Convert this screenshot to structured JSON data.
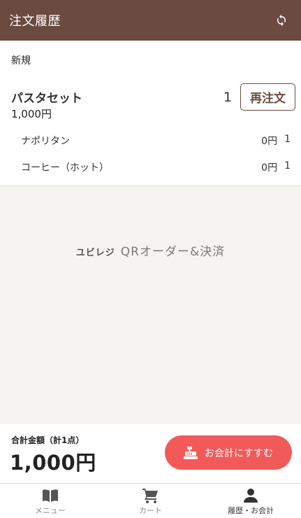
{
  "header": {
    "title": "注文履歴",
    "refresh_icon": "refresh-icon"
  },
  "order": {
    "section_label": "新規",
    "item": {
      "name": "パスタセット",
      "price": "1,000円",
      "quantity": "1",
      "reorder_label": "再注文"
    },
    "sub_items": [
      {
        "name": "ナポリタン",
        "price": "0円",
        "quantity": "1"
      },
      {
        "name": "コーヒー（ホット）",
        "price": "0円",
        "quantity": "1"
      }
    ]
  },
  "brand": {
    "prefix": "ユビレジ",
    "text": "QRオーダー&決済"
  },
  "footer": {
    "total_label": "合計金額（計1点）",
    "total_amount": "1,000円",
    "checkout_label": "お会計にすすむ",
    "checkout_icon": "cash-register-icon",
    "checkout_color": "#f25a5a"
  },
  "tabs": [
    {
      "label": "メニュー",
      "icon": "book-icon"
    },
    {
      "label": "カート",
      "icon": "cart-icon"
    },
    {
      "label": "履歴・お会計",
      "icon": "person-icon",
      "active": true
    }
  ],
  "colors": {
    "header_bg": "#6b4a3f",
    "accent": "#f25a5a"
  }
}
